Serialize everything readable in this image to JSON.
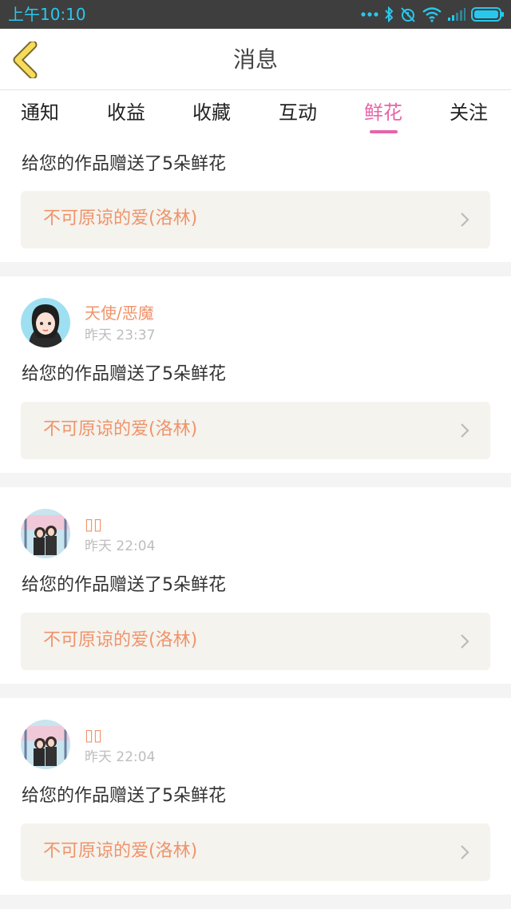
{
  "status_bar": {
    "time": "上午10:10"
  },
  "header": {
    "title": "消息"
  },
  "tabs": [
    {
      "label": "通知"
    },
    {
      "label": "收益"
    },
    {
      "label": "收藏"
    },
    {
      "label": "互动"
    },
    {
      "label": "鲜花",
      "active": true
    },
    {
      "label": "关注"
    }
  ],
  "messages": [
    {
      "text": "给您的作品赠送了5朵鲜花",
      "work_title": "不可原谅的爱(洛林)"
    },
    {
      "user": "天使/恶魔",
      "time": "昨天 23:37",
      "avatar_icon": "avatar-girl-icon",
      "text": "给您的作品赠送了5朵鲜花",
      "work_title": "不可原谅的爱(洛林)"
    },
    {
      "user": "▯▯",
      "time": "昨天 22:04",
      "avatar_icon": "avatar-photo-icon",
      "text": "给您的作品赠送了5朵鲜花",
      "work_title": "不可原谅的爱(洛林)"
    },
    {
      "user": "▯▯",
      "time": "昨天 22:04",
      "avatar_icon": "avatar-photo-icon",
      "text": "给您的作品赠送了5朵鲜花",
      "work_title": "不可原谅的爱(洛林)"
    }
  ],
  "colors": {
    "accent": "#e864a8",
    "link": "#f0936a",
    "status_icon": "#28c8ee"
  }
}
